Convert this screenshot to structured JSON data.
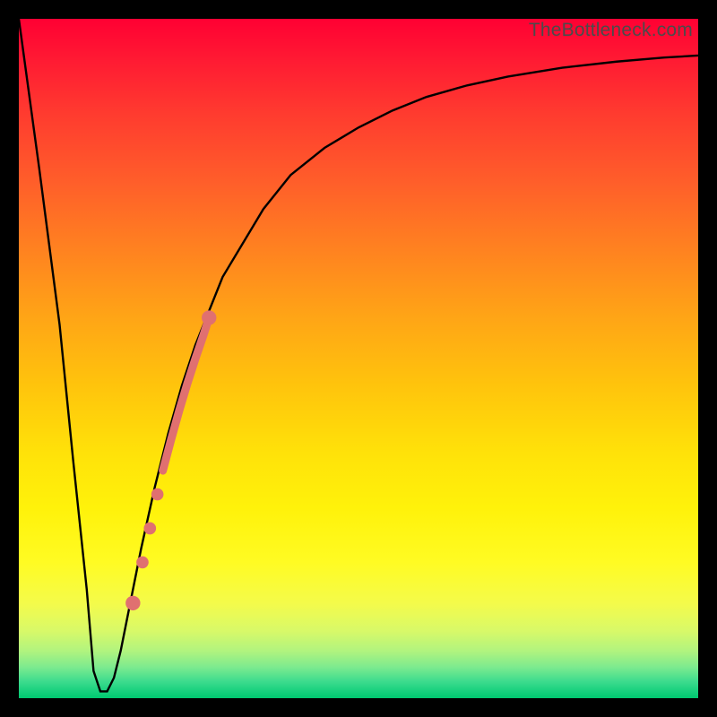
{
  "watermark": "TheBottleneck.com",
  "chart_data": {
    "type": "line",
    "title": "",
    "xlabel": "",
    "ylabel": "",
    "xlim": [
      0,
      100
    ],
    "ylim": [
      0,
      100
    ],
    "series": [
      {
        "name": "bottleneck-curve",
        "x": [
          0,
          3,
          6,
          8,
          10,
          11,
          12,
          13,
          14,
          15,
          16,
          18,
          20,
          22,
          24,
          26,
          28,
          30,
          33,
          36,
          40,
          45,
          50,
          55,
          60,
          66,
          72,
          80,
          88,
          95,
          100
        ],
        "y": [
          100,
          78,
          55,
          35,
          16,
          4,
          1,
          1,
          3,
          7,
          12,
          22,
          31,
          39,
          46,
          52,
          57,
          62,
          67,
          72,
          77,
          81,
          84,
          86.5,
          88.5,
          90.2,
          91.5,
          92.8,
          93.7,
          94.3,
          94.6
        ]
      }
    ],
    "markers": [
      {
        "name": "segment-start",
        "x": 16.8,
        "y": 14,
        "r": 1.2
      },
      {
        "name": "dot-1",
        "x": 18.2,
        "y": 20,
        "r": 1.0
      },
      {
        "name": "dot-2",
        "x": 19.3,
        "y": 25,
        "r": 1.0
      },
      {
        "name": "dot-3",
        "x": 20.4,
        "y": 30,
        "r": 1.0
      },
      {
        "name": "segment-end",
        "x": 28.0,
        "y": 56,
        "r": 1.2
      }
    ],
    "highlight_segment": {
      "name": "highlighted-range",
      "color": "#e07070",
      "width": 9,
      "x": [
        21.2,
        22.4,
        23.6,
        24.8,
        26.0,
        27.2,
        28.0
      ],
      "y": [
        33.5,
        38.0,
        42.3,
        46.3,
        50.0,
        53.5,
        56.0
      ]
    }
  }
}
